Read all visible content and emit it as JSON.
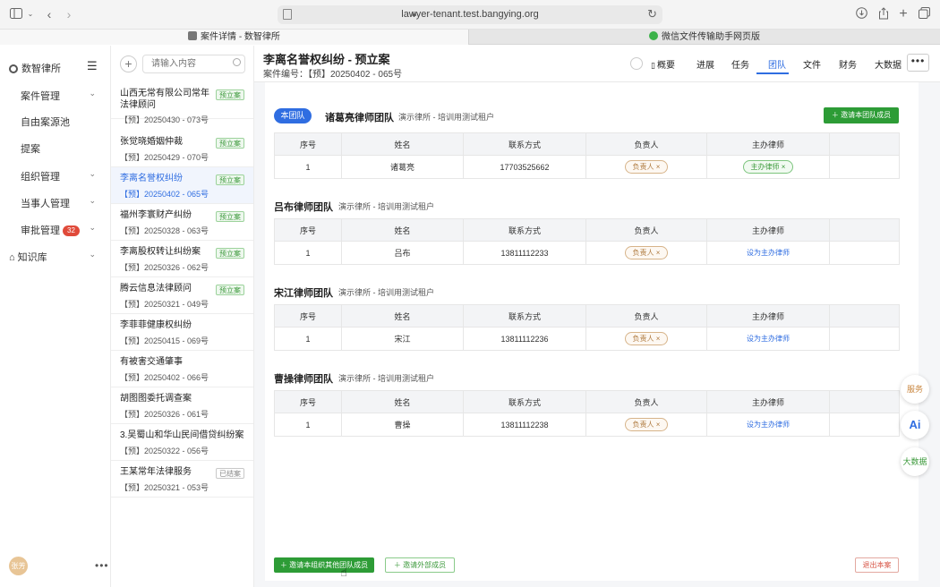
{
  "browser": {
    "url": "lawyer-tenant.test.bangying.org",
    "tabs": [
      {
        "label": "案件详情 - 数智律所",
        "active": true
      },
      {
        "label": "微信文件传输助手网页版",
        "active": false
      }
    ]
  },
  "nav": {
    "brand": "数智律所",
    "items": [
      {
        "label": "案件管理",
        "chevron": true
      },
      {
        "label": "自由案源池",
        "chevron": false
      },
      {
        "label": "提案",
        "chevron": false
      },
      {
        "label": "组织管理",
        "chevron": true
      },
      {
        "label": "当事人管理",
        "chevron": true
      },
      {
        "label": "审批管理",
        "chevron": true,
        "count": "32"
      },
      {
        "label": "知识库",
        "chevron": true
      }
    ],
    "avatar": "张芳"
  },
  "caselist": {
    "search_placeholder": "请输入内容",
    "cases": [
      {
        "title": "山西无常有限公司常年法律顾问",
        "sub": "【预】20250430 - 073号",
        "tag": "预立案"
      },
      {
        "title": "张觉晓婚姻仲裁",
        "sub": "【预】20250429 - 070号",
        "tag": "预立案"
      },
      {
        "title": "李离名誉权纠纷",
        "sub": "【预】20250402 - 065号",
        "tag": "预立案",
        "active": true
      },
      {
        "title": "福州李寰财产纠纷",
        "sub": "【预】20250328 - 063号",
        "tag": "预立案"
      },
      {
        "title": "李离股权转让纠纷案",
        "sub": "【预】20250326 - 062号",
        "tag": "预立案"
      },
      {
        "title": "腾云信息法律顾问",
        "sub": "【预】20250321 - 049号",
        "tag": "预立案"
      },
      {
        "title": "李菲菲健康权纠纷",
        "sub": "【预】20250415 - 069号",
        "tag": ""
      },
      {
        "title": "有被害交通肇事",
        "sub": "【预】20250402 - 066号",
        "tag": ""
      },
      {
        "title": "胡图图委托调查案",
        "sub": "【预】20250326 - 061号",
        "tag": ""
      },
      {
        "title": "3.吴蜀山和华山民间借贷纠纷案",
        "sub": "【预】20250322 - 056号",
        "tag": ""
      },
      {
        "title": "王某常年法律服务",
        "sub": "【预】20250321 - 053号",
        "tag": "已结案",
        "closed": true
      }
    ]
  },
  "main": {
    "title": "李离名誉权纠纷 - 预立案",
    "case_no": "案件编号：【预】20250402 - 065号",
    "tabs": [
      "概要",
      "进展",
      "任务",
      "团队",
      "文件",
      "财务",
      "大数据"
    ],
    "active_tab": "团队",
    "more": "•••"
  },
  "teams": {
    "columns": [
      "序号",
      "姓名",
      "联系方式",
      "负责人",
      "主办律师"
    ],
    "own_badge": "本团队",
    "invite_label": "邀请本团队成员",
    "list": [
      {
        "name": "诸葛亮律师团队",
        "org": "演示律所 - 培训用测试租户",
        "rows": [
          {
            "no": "1",
            "name": "诸葛亮",
            "phone": "17703525662",
            "lead": "负责人 ×",
            "lawyer": "主办律师 ×",
            "lawyer_is_tag": true
          }
        ]
      },
      {
        "name": "吕布律师团队",
        "org": "演示律所 - 培训用测试租户",
        "rows": [
          {
            "no": "1",
            "name": "吕布",
            "phone": "13811112233",
            "lead": "负责人 ×",
            "lawyer": "设为主办律师",
            "lawyer_is_tag": false
          }
        ]
      },
      {
        "name": "宋江律师团队",
        "org": "演示律所 - 培训用测试租户",
        "rows": [
          {
            "no": "1",
            "name": "宋江",
            "phone": "13811112236",
            "lead": "负责人 ×",
            "lawyer": "设为主办律师",
            "lawyer_is_tag": false
          }
        ]
      },
      {
        "name": "曹操律师团队",
        "org": "演示律所 - 培训用测试租户",
        "rows": [
          {
            "no": "1",
            "name": "曹操",
            "phone": "13811112238",
            "lead": "负责人 ×",
            "lawyer": "设为主办律师",
            "lawyer_is_tag": false
          }
        ]
      }
    ]
  },
  "footer": {
    "invite_org": "邀请本组织其他团队成员",
    "invite_external": "邀请外部成员",
    "exit_case": "退出本案"
  },
  "floats": {
    "service": "服务",
    "ai": "Ai",
    "bigdata": "大数据"
  },
  "colors": {
    "accent": "#2f6de1",
    "green": "#2d9c36",
    "lead_pill": "#b07b40",
    "danger": "#d8584a"
  }
}
